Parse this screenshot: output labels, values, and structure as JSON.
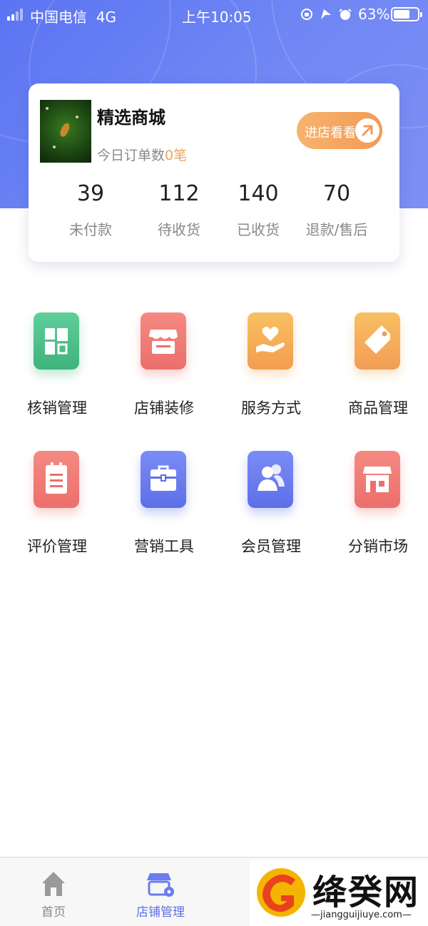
{
  "status_bar": {
    "carrier": "中国电信",
    "network": "4G",
    "time": "上午10:05",
    "battery": "63%"
  },
  "shop": {
    "name": "精选商城",
    "orders_label": "今日订单数",
    "orders_count": "0",
    "orders_unit": "笔",
    "visit_button": "进店看看"
  },
  "stats": [
    {
      "value": "39",
      "label": "未付款"
    },
    {
      "value": "112",
      "label": "待收货"
    },
    {
      "value": "140",
      "label": "已收货"
    },
    {
      "value": "70",
      "label": "退款/售后"
    }
  ],
  "menu": [
    {
      "label": "核销管理",
      "icon": "grid-icon",
      "color": "#4fc08d"
    },
    {
      "label": "店铺装修",
      "icon": "storefront-icon",
      "color": "#f07b76"
    },
    {
      "label": "服务方式",
      "icon": "heart-hand-icon",
      "color": "#f6b25c"
    },
    {
      "label": "商品管理",
      "icon": "tag-icon",
      "color": "#f4b560"
    },
    {
      "label": "评价管理",
      "icon": "clipboard-icon",
      "color": "#f07b76"
    },
    {
      "label": "营销工具",
      "icon": "briefcase-icon",
      "color": "#6a7cf0"
    },
    {
      "label": "会员管理",
      "icon": "users-icon",
      "color": "#6a7cf0"
    },
    {
      "label": "分销市场",
      "icon": "shop-icon",
      "color": "#f07b76"
    }
  ],
  "tabbar": [
    {
      "label": "首页",
      "icon": "home-icon",
      "active": false
    },
    {
      "label": "店铺管理",
      "icon": "store-settings-icon",
      "active": true
    }
  ],
  "watermark": {
    "title": "绛癸网",
    "url": "jiangguijiuye.com"
  }
}
